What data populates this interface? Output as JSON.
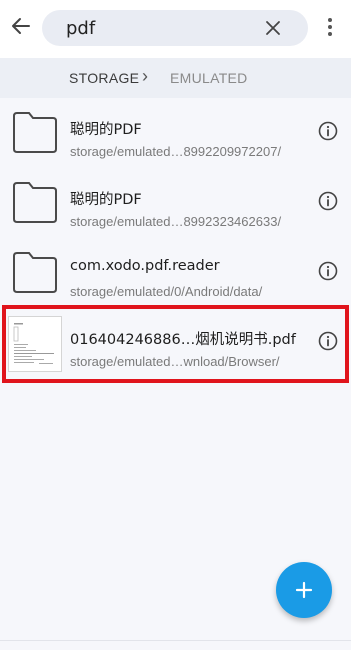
{
  "search": {
    "query": "pdf"
  },
  "icons": {
    "back": "arrow-left-icon",
    "clear": "close-icon",
    "more": "more-vert-icon",
    "folder": "folder-icon",
    "info": "info-icon",
    "add": "plus-icon"
  },
  "breadcrumb": {
    "items": [
      "STORAGE",
      "EMULATED"
    ],
    "separator": "›"
  },
  "files": [
    {
      "name": "聪明的PDF",
      "path": "storage/emulated…8992209972207/",
      "type": "folder"
    },
    {
      "name": "聪明的PDF",
      "path": "storage/emulated…8992323462633/",
      "type": "folder"
    },
    {
      "name": "com.xodo.pdf.reader",
      "path": "storage/emulated/0/Android/data/",
      "type": "folder"
    },
    {
      "name": "016404246886…烟机说明书.pdf",
      "path": "storage/emulated…wnload/Browser/",
      "type": "pdf",
      "highlighted": true
    }
  ],
  "colors": {
    "accent": "#1a9be6",
    "highlight": "#e0141c"
  }
}
